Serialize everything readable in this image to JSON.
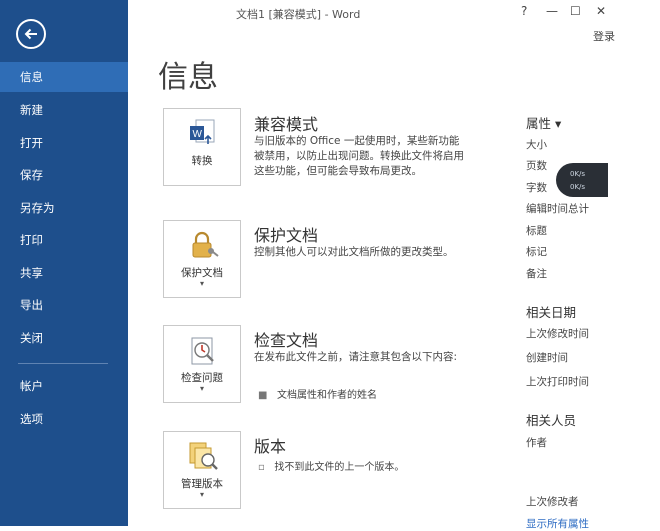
{
  "window": {
    "title": "文档1 [兼容模式] - Word",
    "help": "?",
    "minimize": "—",
    "restore": "☐",
    "close": "✕",
    "signin": "登录"
  },
  "sidebar": {
    "items": [
      {
        "label": "信息",
        "active": true
      },
      {
        "label": "新建"
      },
      {
        "label": "打开"
      },
      {
        "label": "保存"
      },
      {
        "label": "另存为"
      },
      {
        "label": "打印"
      },
      {
        "label": "共享"
      },
      {
        "label": "导出"
      },
      {
        "label": "关闭"
      }
    ],
    "bottom_items": [
      {
        "label": "帐户"
      },
      {
        "label": "选项"
      }
    ],
    "colors": {
      "background": "#1e4f8c",
      "active": "#2f6db6"
    }
  },
  "main": {
    "heading": "信息",
    "sections": [
      {
        "button_label": "转换",
        "button_icon": "word-convert-icon",
        "title": "兼容模式",
        "description": "与旧版本的 Office 一起使用时，某些新功能被禁用，以防止出现问题。转换此文件将启用这些功能，但可能会导致布局更改。"
      },
      {
        "button_label": "保护文档",
        "button_icon": "lock-key-icon",
        "title": "保护文档",
        "description": "控制其他人可以对此文档所做的更改类型。"
      },
      {
        "button_label": "检查问题",
        "button_icon": "inspect-document-icon",
        "title": "检查文档",
        "description": "在发布此文件之前，请注意其包含以下内容:",
        "bullets": [
          "文档属性和作者的姓名"
        ]
      },
      {
        "button_label": "管理版本",
        "button_icon": "manage-versions-icon",
        "title": "版本",
        "bullets": [
          "找不到此文件的上一个版本。"
        ]
      }
    ]
  },
  "properties": {
    "header": "属性 ▾",
    "items": [
      "大小",
      "页数",
      "字数",
      "编辑时间总计",
      "标题",
      "标记",
      "备注"
    ],
    "dates_header": "相关日期",
    "dates": [
      "上次修改时间",
      "创建时间",
      "上次打印时间"
    ],
    "people_header": "相关人员",
    "people": [
      "作者"
    ],
    "last_modified_by": "上次修改者",
    "show_all": "显示所有属性"
  },
  "speed_overlay": {
    "up": "0K/s",
    "down": "0K/s"
  }
}
